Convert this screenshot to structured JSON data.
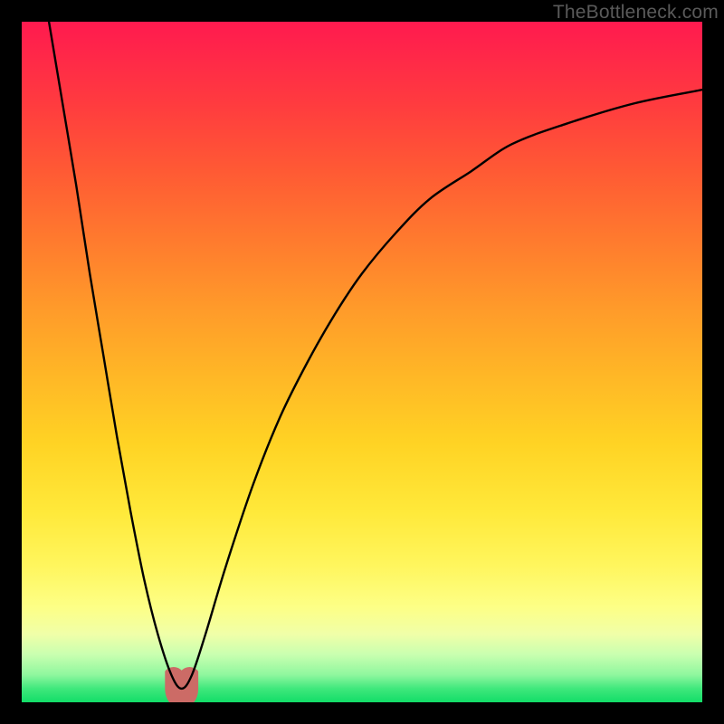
{
  "watermark": {
    "text": "TheBottleneck.com"
  },
  "chart_data": {
    "type": "line",
    "title": "",
    "xlabel": "",
    "ylabel": "",
    "xlim": [
      0,
      100
    ],
    "ylim": [
      0,
      100
    ],
    "legend": null,
    "grid": false,
    "background": "red-yellow-green vertical gradient",
    "series": [
      {
        "name": "bottleneck-curve",
        "x": [
          4,
          6,
          8,
          10,
          12,
          14,
          16,
          18,
          20,
          22,
          23.5,
          25,
          27,
          30,
          34,
          38,
          42,
          46,
          50,
          55,
          60,
          66,
          72,
          80,
          90,
          100
        ],
        "y": [
          100,
          88,
          76,
          63,
          51,
          39,
          28,
          18,
          10,
          4,
          2,
          4,
          10,
          20,
          32,
          42,
          50,
          57,
          63,
          69,
          74,
          78,
          82,
          85,
          88,
          90
        ]
      }
    ],
    "markers": [
      {
        "name": "valley-marker",
        "x": 23.5,
        "y": 2,
        "color": "#cc6b66",
        "radius_px": 16
      }
    ]
  }
}
